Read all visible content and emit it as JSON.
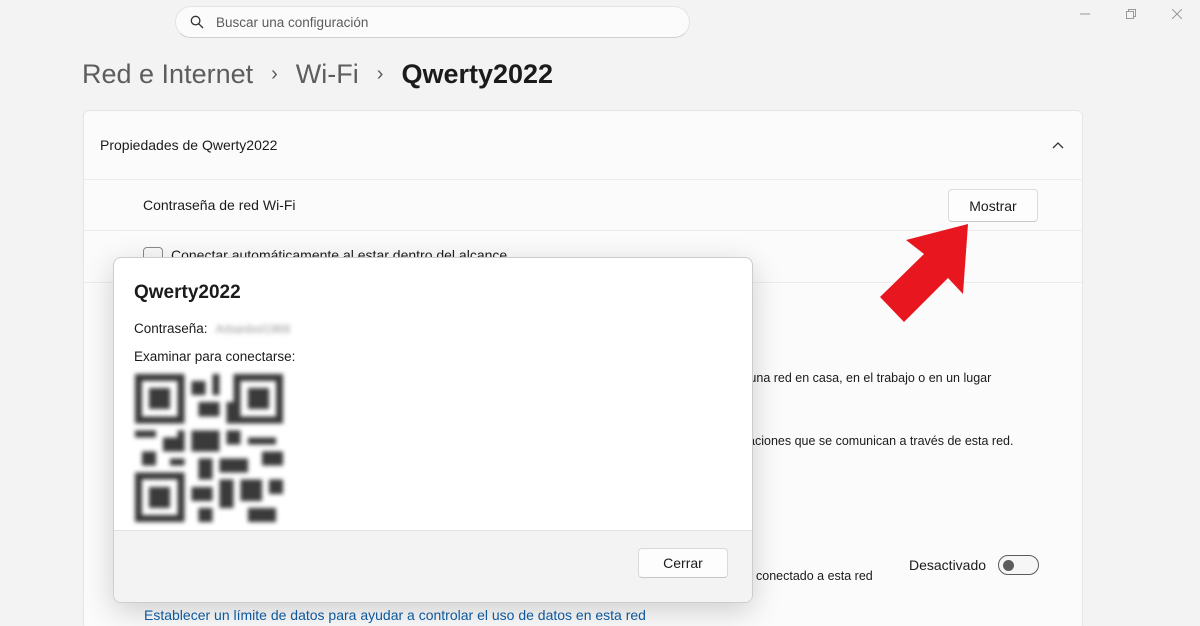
{
  "search": {
    "placeholder": "Buscar una configuración",
    "icon": "search-icon"
  },
  "window_controls": [
    "minimize-icon",
    "restore-icon",
    "close-icon"
  ],
  "breadcrumb": {
    "items": [
      "Red e Internet",
      "Wi-Fi"
    ],
    "current": "Qwerty2022"
  },
  "card": {
    "title": "Propiedades de Qwerty2022",
    "password_label": "Contraseña de red Wi-Fi",
    "show_button": "Mostrar",
    "auto_connect_label": "Conectar automáticamente al estar dentro del alcance"
  },
  "background": {
    "network_profile_text": "a una red en casa, en el trabajo o en un lugar",
    "apps_text": "icaciones que se comunican a través de esta red.",
    "metered_text": "conectado a esta red",
    "metered_toggle_label": "Desactivado",
    "metered_toggle_on": false,
    "data_limit_link": "Establecer un límite de datos para ayudar a controlar el uso de datos en esta red"
  },
  "dialog": {
    "title": "Qwerty2022",
    "password_label": "Contraseña:",
    "password_value": "Arbanbol1968",
    "scan_label": "Examinar para conectarse:",
    "close_button": "Cerrar"
  },
  "colors": {
    "background": "#f3f3f3",
    "card": "#fbfbfb",
    "link": "#0f5fa8",
    "arrow": "#e8161f"
  }
}
